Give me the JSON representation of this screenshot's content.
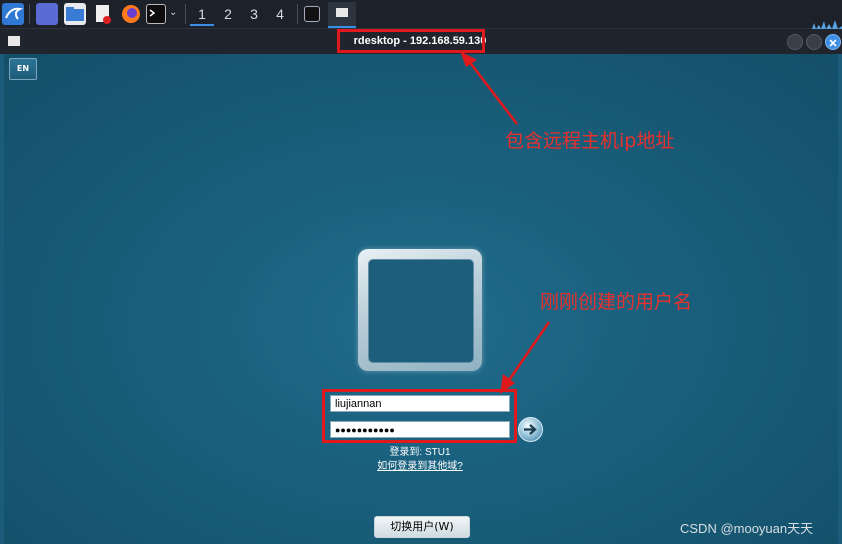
{
  "taskbar": {
    "workspaces": [
      "1",
      "2",
      "3",
      "4"
    ]
  },
  "window": {
    "title": "rdesktop - 192.168.59.130"
  },
  "login": {
    "lang_indicator": "EN",
    "username": "liujiannan",
    "password_mask": "●●●●●●●●●●●",
    "login_to": "登录到: STU1",
    "other_domain_link": "如何登录到其他域?",
    "switch_user_label": "切换用户(W)"
  },
  "annotations": {
    "ip_note": "包含远程主机ip地址",
    "user_note": "刚刚创建的用户名"
  },
  "watermark": "CSDN @mooyuan天天",
  "colors": {
    "desktop_bg": "#1a5c7a",
    "annotation_red": "#e0191c",
    "taskbar_bg": "#1d2129"
  }
}
